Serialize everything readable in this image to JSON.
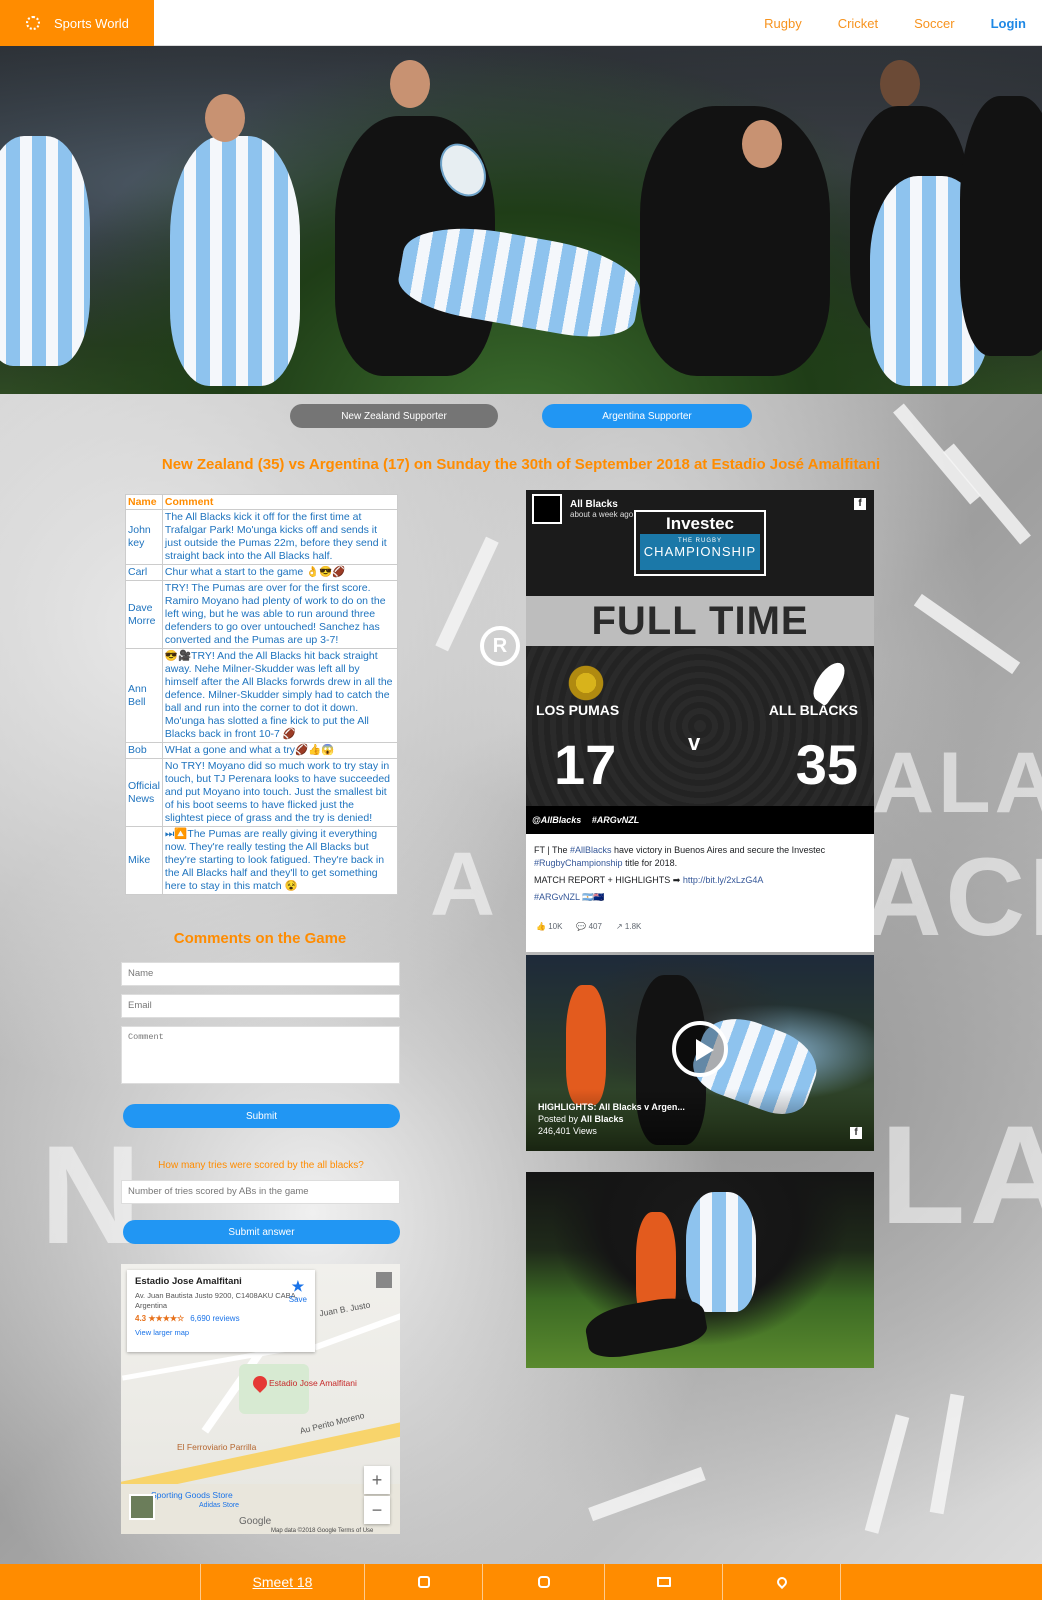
{
  "nav": {
    "brand": "Sports World",
    "links": [
      "Rugby",
      "Cricket",
      "Soccer"
    ],
    "login": "Login"
  },
  "buttons": {
    "nz_supporter": "New Zealand Supporter",
    "ar_supporter": "Argentina Supporter"
  },
  "match_title": "New Zealand (35) vs Argentina (17) on Sunday the 30th of September 2018 at Estadio José Amalfitani",
  "comments_table": {
    "headers": [
      "Name",
      "Comment"
    ],
    "rows": [
      {
        "name": "John key",
        "comment": "The All Blacks kick it off for the first time at Trafalgar Park! Mo'unga kicks off and sends it just outside the Pumas 22m, before they send it straight back into the All Blacks half."
      },
      {
        "name": "Carl",
        "comment": "Chur what a start to the game 👌😎🏈"
      },
      {
        "name": "Dave Morre",
        "comment": "TRY! The Pumas are over for the first score. Ramiro Moyano had plenty of work to do on the left wing, but he was able to run around three defenders to go over untouched! Sanchez has converted and the Pumas are up 3-7!"
      },
      {
        "name": "Ann Bell",
        "comment": "😎🎥TRY! And the All Blacks hit back straight away. Nehe Milner-Skudder was left all by himself after the All Blacks forwrds drew in all the defence. Milner-Skudder simply had to catch the ball and run into the corner to dot it down. Mo'unga has slotted a fine kick to put the All Blacks back in front 10-7 🏈"
      },
      {
        "name": "Bob",
        "comment": "WHat a gone and what a try🏈👍😱"
      },
      {
        "name": "Official News",
        "comment": "No TRY! Moyano did so much work to try stay in touch, but TJ Perenara looks to have succeeded and put Moyano into touch. Just the smallest bit of his boot seems to have flicked just the slightest piece of grass and the try is denied!"
      },
      {
        "name": "Mike",
        "comment": "⏭🔼The Pumas are really giving it everything now. They're really testing the All Blacks but they're starting to look fatigued. They're back in the All Blacks half and they'll to get something here to stay in this match 😵"
      }
    ]
  },
  "comment_form": {
    "title": "Comments on the Game",
    "name_placeholder": "Name",
    "email_placeholder": "Email",
    "comment_placeholder": "Comment",
    "submit": "Submit"
  },
  "quiz": {
    "question": "How many tries were scored by the all blacks?",
    "placeholder": "Number of tries scored by ABs in the game",
    "submit": "Submit answer"
  },
  "map": {
    "place": "Estadio Jose Amalfitani",
    "address": "Av. Juan Bautista Justo 9200, C1408AKU CABA, Argentina",
    "rating": "4.3 ★★★★☆",
    "reviews": "6,690 reviews",
    "larger_map": "View larger map",
    "save": "Save",
    "pin_label": "Estadio Jose Amalfitani",
    "street1": "Juan B. Justo",
    "street2": "Au Perito Moreno",
    "street3": "El Ferroviario Parrilla",
    "street4": "Sporting Goods Store",
    "street5": "Adidas Store",
    "google": "Google",
    "attribution": "Map data ©2018 Google   Terms of Use"
  },
  "fb_post": {
    "page": "All Blacks",
    "time": "about a week ago",
    "investec": "Investec",
    "investec_sub": "THE RUGBY",
    "investec_champ": "CHAMPIONSHIP",
    "full_time": "FULL TIME",
    "team_left": "LOS PUMAS",
    "team_right": "ALL BLACKS",
    "score_left": "17",
    "score_right": "35",
    "vs": "v",
    "hashtags": "@AllBlacks #ARGvNZL",
    "text1": "FT | The ",
    "text1_tag": "#AllBlacks",
    "text1_rest": " have victory in Buenos Aires and secure the Investec ",
    "text1_tag2": "#RugbyChampionship",
    "text1_end": " title for 2018.",
    "text2": "MATCH REPORT + HIGHLIGHTS ➡ ",
    "text2_link": "http://bit.ly/2xLzG4A",
    "text3_tag": "#ARGvNZL",
    "text3_flags": " 🇦🇷🇳🇿",
    "likes": "10K",
    "comments": "407",
    "shares": "1.8K"
  },
  "fb_video": {
    "title": "HIGHLIGHTS: All Blacks v Argen...",
    "posted_by": "Posted by ",
    "posted_by_name": "All Blacks",
    "views": "246,401 Views"
  },
  "footer": {
    "link": "Smeet 18"
  },
  "colors": {
    "brand": "#ff8c00",
    "accent": "#2196f3",
    "link": "#1e73be"
  }
}
